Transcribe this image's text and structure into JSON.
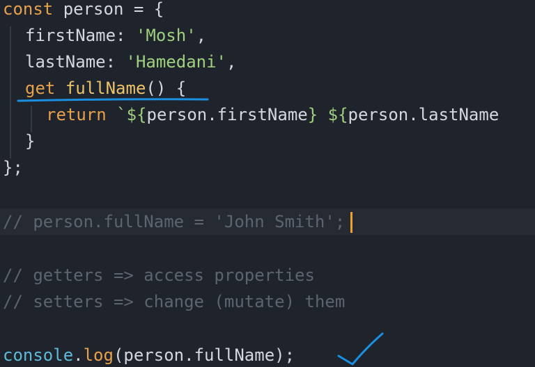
{
  "code": {
    "l1": {
      "kw": "const",
      "name": " person ",
      "op": "= {"
    },
    "l2": {
      "key": "firstName",
      "colon": ": ",
      "val": "'Mosh'",
      "comma": ","
    },
    "l3": {
      "key": "lastName",
      "colon": ": ",
      "val": "'Hamedani'",
      "comma": ","
    },
    "l4": {
      "kw": "get",
      "space": " ",
      "name": "fullName",
      "rest": "() {"
    },
    "l5": {
      "kw": "return",
      "space": " ",
      "tick": "`",
      "i1a": "${",
      "i1b": "person",
      "i1c": ".",
      "i1d": "firstName",
      "i1e": "}",
      "sp": " ",
      "i2a": "${",
      "i2b": "person",
      "i2c": ".",
      "i2d": "lastName"
    },
    "l6": {
      "text": "}"
    },
    "l7": {
      "text": "};"
    },
    "l8": {
      "text": "// person.fullName = 'John Smith';"
    },
    "l9": {
      "text": "// getters => access properties"
    },
    "l10": {
      "text": "// setters => change (mutate) them"
    },
    "l11": {
      "obj": "console",
      "dot": ".",
      "fn": "log",
      "args": "(person.fullName);"
    }
  },
  "colors": {
    "background": "#1f242c",
    "keyword": "#e8a14b",
    "string": "#9fd07e",
    "comment": "#5d6470",
    "annotation": "#1b8fe0",
    "cursor": "#f0a030"
  }
}
